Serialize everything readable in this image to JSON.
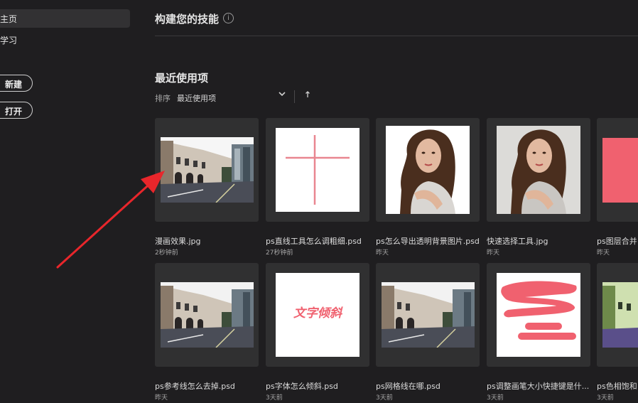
{
  "sidebar": {
    "home_label": "主页",
    "learn_label": "学习",
    "new_label": "新建",
    "open_label": "打开"
  },
  "header": {
    "title": "构建您的技能",
    "info_icon": "info-icon"
  },
  "recent": {
    "title": "最近使用项",
    "sort_label": "排序",
    "sort_value": "最近使用项",
    "sort_chevron": "chevron-down-icon",
    "sort_order_icon": "arrow-up-icon"
  },
  "files_row1": [
    {
      "name": "漫画效果.jpg",
      "time": "2秒钟前"
    },
    {
      "name": "ps直线工具怎么调粗细.psd",
      "time": "27秒钟前"
    },
    {
      "name": "ps怎么导出透明背景图片.psd",
      "time": "昨天"
    },
    {
      "name": "快速选择工具.jpg",
      "time": "昨天"
    },
    {
      "name": "ps图层合并",
      "time": "昨天"
    }
  ],
  "files_row2": [
    {
      "name": "ps参考线怎么去掉.psd",
      "time": "昨天"
    },
    {
      "name": "ps字体怎么倾斜.psd",
      "time": "3天前",
      "thumb_text": "文字倾斜"
    },
    {
      "name": "ps网格线在哪.psd",
      "time": "3天前"
    },
    {
      "name": "ps调整画笔大小快捷键是什...",
      "time": "3天前"
    },
    {
      "name": "ps色相饱和",
      "time": "3天前"
    }
  ],
  "colors": {
    "background": "#1f1e20",
    "card": "#303031",
    "accent_pink": "#f0616f",
    "arrow_red": "#e8262b"
  }
}
